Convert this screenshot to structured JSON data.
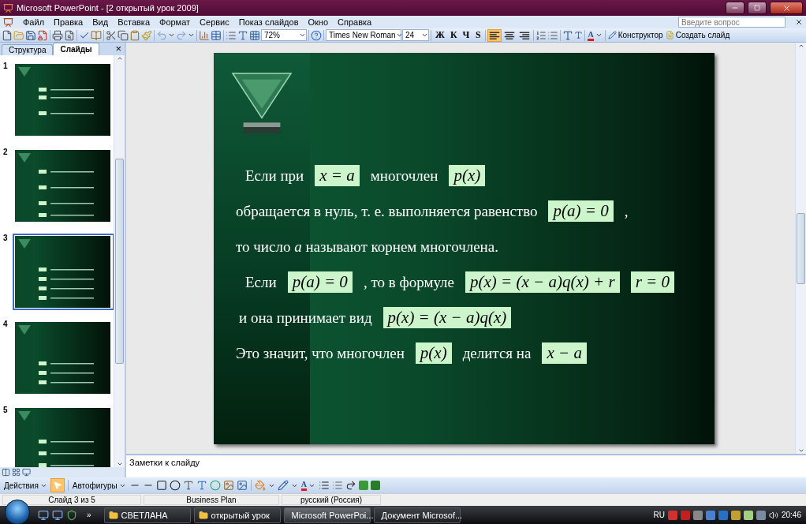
{
  "window": {
    "title": "Microsoft PowerPoint - [2 открытый урок 2009]"
  },
  "menu": [
    "Файл",
    "Правка",
    "Вид",
    "Вставка",
    "Формат",
    "Сервис",
    "Показ слайдов",
    "Окно",
    "Справка"
  ],
  "help_search": {
    "placeholder": "Введите вопрос"
  },
  "toolbar": {
    "zoom": "72%",
    "font": "Times New Roman",
    "size": "24",
    "format_buttons": [
      "Ж",
      "К",
      "Ч",
      "S"
    ],
    "alignment": [
      {
        "selected": true
      },
      {
        "selected": false
      },
      {
        "selected": false
      }
    ],
    "font_color_label": "A",
    "design_button": "Конструктор",
    "new_slide_button": "Создать слайд"
  },
  "side_panel": {
    "tabs": [
      {
        "label": "Структура",
        "selected": false
      },
      {
        "label": "Слайды",
        "selected": true
      }
    ],
    "close": "×",
    "slides": [
      {
        "number": "1",
        "selected": false
      },
      {
        "number": "2",
        "selected": false
      },
      {
        "number": "3",
        "selected": true
      },
      {
        "number": "4",
        "selected": false
      },
      {
        "number": "5",
        "selected": false
      }
    ]
  },
  "slide": {
    "lines": [
      {
        "segments": [
          {
            "kind": "text",
            "text": "Если при"
          },
          {
            "kind": "formula",
            "text": "x = a"
          },
          {
            "kind": "text",
            "text": "многочлен"
          },
          {
            "kind": "formula",
            "text": "p(x)"
          }
        ]
      },
      {
        "segments": [
          {
            "kind": "text",
            "text": "обращается в нуль, т. е. выполняется равенство"
          },
          {
            "kind": "formula",
            "text": "p(a) = 0"
          },
          {
            "kind": "text",
            "text": ","
          }
        ]
      },
      {
        "segments": [
          {
            "kind": "text",
            "text": "то число *a*  называют корнем многочлена."
          }
        ]
      },
      {
        "segments": [
          {
            "kind": "text",
            "text": "Если"
          },
          {
            "kind": "formula",
            "text": "p(a) = 0"
          },
          {
            "kind": "text",
            "text": ", то в формуле"
          },
          {
            "kind": "formula",
            "text": "p(x) = (x − a)q(x) + r"
          },
          {
            "kind": "formula",
            "text": "r = 0"
          }
        ]
      },
      {
        "segments": [
          {
            "kind": "text",
            "text": "и она принимает вид"
          },
          {
            "kind": "formula",
            "text": "p(x) = (x − a)q(x)"
          }
        ]
      },
      {
        "segments": [
          {
            "kind": "text",
            "text": "Это значит, что многочлен"
          },
          {
            "kind": "formula",
            "text": "p(x)"
          },
          {
            "kind": "text",
            "text": "делится на"
          },
          {
            "kind": "formula",
            "text": "x − a"
          }
        ]
      }
    ]
  },
  "notes": {
    "placeholder": "Заметки к слайду"
  },
  "drawing_toolbar": {
    "actions": "Действия",
    "autoshapes": "Автофигуры",
    "font_color_label": "A"
  },
  "status_bar": [
    "Слайд 3 из 5",
    "Business Plan",
    "русский (Россия)"
  ],
  "taskbar": {
    "overflow": "»",
    "items": [
      {
        "label": "СВЕТЛАНА",
        "selected": false
      },
      {
        "label": "открытый урок",
        "selected": false
      },
      {
        "label": "Microsoft PowerPoi...",
        "selected": true
      },
      {
        "label": "Документ Microsof...",
        "selected": false
      }
    ],
    "language": "RU",
    "time": "20:46"
  }
}
